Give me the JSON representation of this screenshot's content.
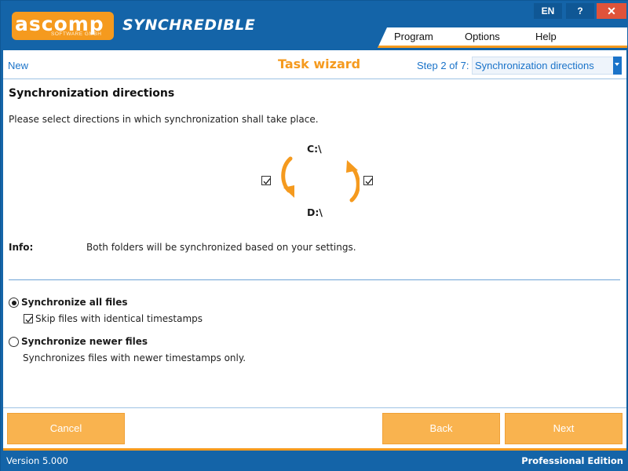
{
  "brand": {
    "logo_text": "ascomp",
    "logo_sub": "SOFTWARE GMBH",
    "app_name": "SYNCHREDIBLE"
  },
  "titlebar": {
    "language": "EN",
    "help": "?",
    "close": "✕"
  },
  "menu": {
    "items": [
      {
        "label": "Program"
      },
      {
        "label": "Options"
      },
      {
        "label": "Help"
      }
    ]
  },
  "header": {
    "new_label": "New",
    "title": "Task wizard",
    "step_label": "Step 2 of 7:",
    "step_value": "Synchronization directions"
  },
  "main": {
    "section_title": "Synchronization directions",
    "section_desc": "Please select directions in which synchronization shall take place.",
    "source_drive": "C:\\",
    "target_drive": "D:\\",
    "direction_down_checked": true,
    "direction_up_checked": true,
    "info_label": "Info:",
    "info_text": "Both folders will be synchronized based on your settings.",
    "options": {
      "all_files_label": "Synchronize all files",
      "all_files_selected": true,
      "skip_identical_label": "Skip files with identical timestamps",
      "skip_identical_checked": true,
      "newer_files_label": "Synchronize newer files",
      "newer_files_selected": false,
      "newer_files_desc": "Synchronizes files with newer timestamps only."
    }
  },
  "buttons": {
    "cancel": "Cancel",
    "back": "Back",
    "next": "Next"
  },
  "status": {
    "version": "Version 5.000",
    "edition": "Professional Edition"
  },
  "colors": {
    "brand_blue": "#1464a8",
    "accent_orange": "#f59a1e",
    "link_blue": "#1a73c9",
    "button_orange": "#f9b34f"
  }
}
